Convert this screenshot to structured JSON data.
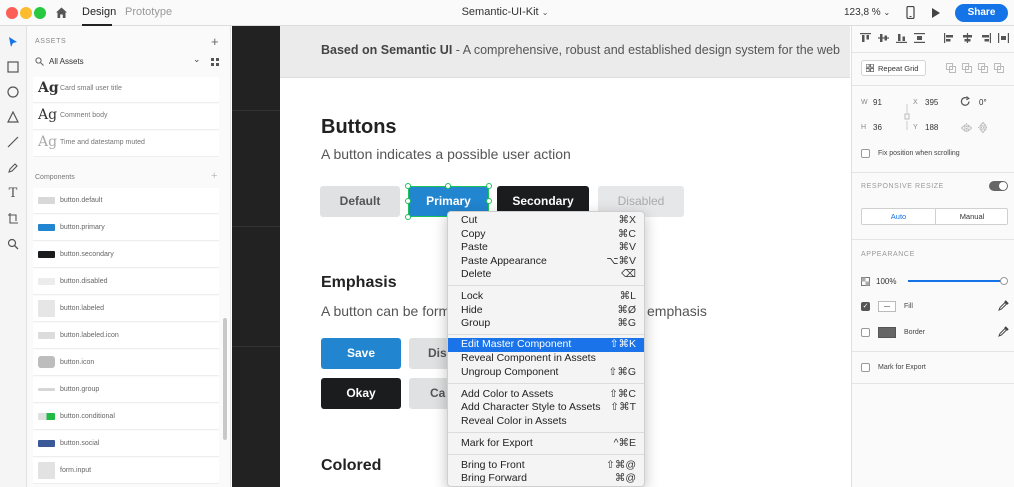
{
  "titlebar": {
    "tabs": [
      "Design",
      "Prototype"
    ],
    "doc_title": "Semantic-UI-Kit",
    "zoom": "123,8 %",
    "share": "Share"
  },
  "assets": {
    "header": "ASSETS",
    "filter": "All Assets",
    "char_styles": [
      {
        "ag": "Ag",
        "label": "Card small user title"
      },
      {
        "ag": "Ag",
        "label": "Comment body"
      },
      {
        "ag": "Ag",
        "label": "Time and datestamp muted"
      }
    ],
    "components_header": "Components",
    "components": [
      "button.default",
      "button.primary",
      "button.secondary",
      "button.disabled",
      "button.labeled",
      "button.labeled.icon",
      "button.icon",
      "button.group",
      "button.conditional",
      "button.social",
      "form.input"
    ]
  },
  "canvas": {
    "hero_bold": "Based on Semantic UI",
    "hero_rest": " - A comprehensive, robust and established design system for the web",
    "buttons_title": "Buttons",
    "buttons_sub": "A button indicates a possible user action",
    "btn_default": "Default",
    "btn_primary": "Primary",
    "btn_secondary": "Secondary",
    "btn_disabled": "Disabled",
    "emphasis_title": "Emphasis",
    "emphasis_sub_a": "A button can be form",
    "emphasis_sub_b": "emphasis",
    "btn_save": "Save",
    "btn_dis": "Dis",
    "btn_okay": "Okay",
    "btn_ca": "Ca",
    "colored_title": "Colored"
  },
  "context_menu": {
    "items": [
      {
        "label": "Cut",
        "key": "⌘X"
      },
      {
        "label": "Copy",
        "key": "⌘C"
      },
      {
        "label": "Paste",
        "key": "⌘V"
      },
      {
        "label": "Paste Appearance",
        "key": "⌥⌘V"
      },
      {
        "label": "Delete",
        "key": "⌫"
      },
      {
        "label": "Lock",
        "key": "⌘L"
      },
      {
        "label": "Hide",
        "key": "⌘Ø"
      },
      {
        "label": "Group",
        "key": "⌘G"
      },
      {
        "label": "Edit Master Component",
        "key": "⇧⌘K"
      },
      {
        "label": "Reveal Component in Assets",
        "key": ""
      },
      {
        "label": "Ungroup Component",
        "key": "⇧⌘G"
      },
      {
        "label": "Add Color to Assets",
        "key": "⇧⌘C"
      },
      {
        "label": "Add Character Style to Assets",
        "key": "⇧⌘T"
      },
      {
        "label": "Reveal Color in Assets",
        "key": ""
      },
      {
        "label": "Mark for Export",
        "key": "^⌘E"
      },
      {
        "label": "Bring to Front",
        "key": "⇧⌘@"
      },
      {
        "label": "Bring Forward",
        "key": "⌘@"
      }
    ]
  },
  "props": {
    "repeat_grid": "Repeat Grid",
    "w_label": "W",
    "w_val": "91",
    "x_label": "X",
    "x_val": "395",
    "rot_val": "0°",
    "h_label": "H",
    "h_val": "36",
    "y_label": "Y",
    "y_val": "188",
    "fix_position": "Fix position when scrolling",
    "responsive_resize": "RESPONSIVE RESIZE",
    "auto": "Auto",
    "manual": "Manual",
    "appearance": "APPEARANCE",
    "opacity": "100%",
    "fill": "Fill",
    "border": "Border",
    "mark_export": "Mark for Export"
  },
  "colors": {
    "accent": "#1473e6",
    "primary_button": "#2185d0",
    "secondary_button": "#1b1c1d",
    "menu_highlight": "#1a73e8"
  }
}
